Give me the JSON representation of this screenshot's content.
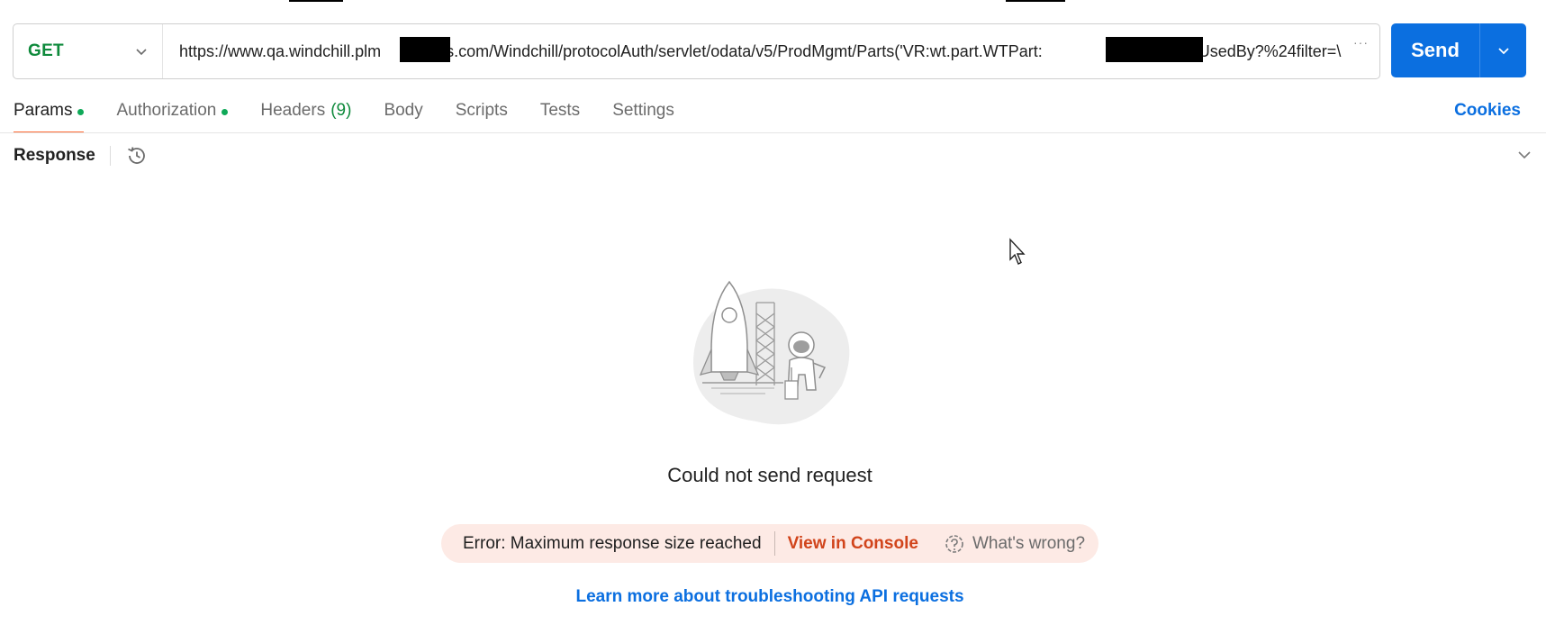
{
  "request": {
    "method": "GET",
    "url": "https://www.qa.windchill.plm    s.com/Windchill/protocolAuth/servlet/odata/v5/ProdMgmt/Parts('VR:wt.part.WTPart:         )/UsedBy?%24filter=\\",
    "more": "···"
  },
  "send": {
    "label": "Send"
  },
  "tabs": [
    {
      "label": "Params",
      "dot": true
    },
    {
      "label": "Authorization",
      "dot": true
    },
    {
      "label": "Headers",
      "count": "(9)"
    },
    {
      "label": "Body"
    },
    {
      "label": "Scripts"
    },
    {
      "label": "Tests"
    },
    {
      "label": "Settings"
    }
  ],
  "cookies": "Cookies",
  "response": {
    "title": "Response",
    "message": "Could not send request",
    "error": "Error: Maximum response size reached",
    "view_console": "View in Console",
    "whats_wrong": "What's wrong?",
    "learn_more": "Learn more about troubleshooting API requests"
  },
  "colors": {
    "accent": "#0b6fe0",
    "method_get": "#0f8a3c",
    "tab_indicator": "#ff6c37",
    "error_bg": "#fdeae5",
    "error_link": "#d1441b"
  },
  "icons": [
    "chevron-down-icon",
    "history-icon",
    "collapse-chevron-icon",
    "rocket-illustration",
    "whats-wrong-icon",
    "mouse-cursor-icon"
  ]
}
